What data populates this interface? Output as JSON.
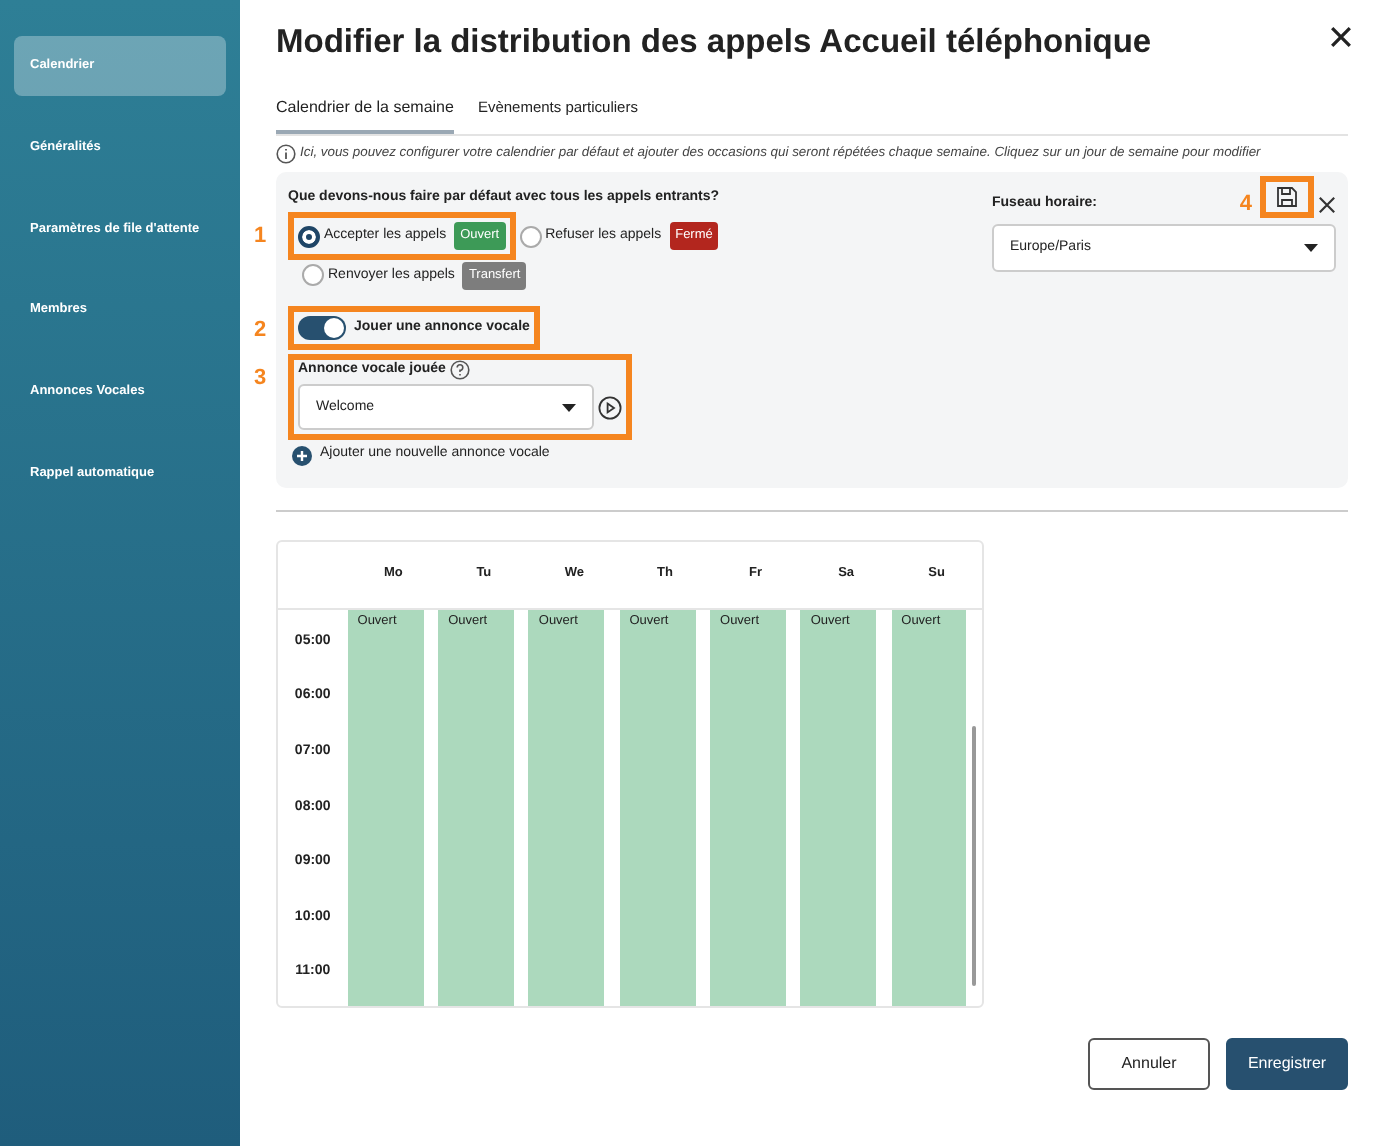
{
  "sidebar": {
    "items": [
      {
        "label": "Calendrier",
        "selected": true
      },
      {
        "label": "Généralités",
        "selected": false
      },
      {
        "label": "Paramètres de file d'attente",
        "selected": false
      },
      {
        "label": "Membres",
        "selected": false
      },
      {
        "label": "Annonces Vocales",
        "selected": false
      },
      {
        "label": "Rappel automatique",
        "selected": false
      }
    ]
  },
  "dialog": {
    "title": "Modifier la distribution des appels Accueil téléphonique",
    "tabs": [
      {
        "label": "Calendrier de la semaine",
        "selected": true
      },
      {
        "label": "Evènements particuliers",
        "selected": false
      }
    ],
    "info": "Ici, vous pouvez configurer votre calendrier par défaut et ajouter des occasions qui seront répétées chaque semaine. Cliquez sur un jour de semaine pour modifier",
    "default_action": {
      "question": "Que devons-nous faire par défaut avec tous les appels entrants?",
      "callout": "1",
      "options": [
        {
          "label": "Accepter les appels",
          "badge": "Ouvert",
          "color": "#3d9a57",
          "selected": true
        },
        {
          "label": "Refuser les appels",
          "badge": "Fermé",
          "color": "#b3261e",
          "selected": false
        },
        {
          "label": "Renvoyer les appels",
          "badge": "Transfert",
          "color": "#7d7d7d",
          "selected": false
        }
      ]
    },
    "timezone": {
      "label": "Fuseau horaire:",
      "value": "Europe/Paris",
      "callout": "4"
    },
    "announcement_toggle": {
      "label": "Jouer une annonce vocale",
      "on": true,
      "callout": "2"
    },
    "announcement": {
      "label": "Annonce vocale jouée",
      "value": "Welcome",
      "callout": "3"
    },
    "add_announcement": "Ajouter une nouvelle annonce vocale",
    "calendar": {
      "days": [
        "Mo",
        "Tu",
        "We",
        "Th",
        "Fr",
        "Sa",
        "Su"
      ],
      "times": [
        "05:00",
        "06:00",
        "07:00",
        "08:00",
        "09:00",
        "10:00",
        "11:00"
      ],
      "blocks": [
        "Ouvert",
        "Ouvert",
        "Ouvert",
        "Ouvert",
        "Ouvert",
        "Ouvert",
        "Ouvert"
      ]
    },
    "buttons": [
      {
        "label": "Annuler",
        "kind": "secondary"
      },
      {
        "label": "Enregistrer",
        "kind": "primary"
      }
    ]
  }
}
